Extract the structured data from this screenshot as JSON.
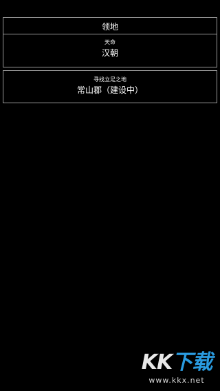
{
  "territory": {
    "header": "领地",
    "mandate_label": "天命",
    "mandate_value": "汉朝"
  },
  "quest": {
    "label": "寻找立足之地",
    "value": "常山郡（建设中）"
  },
  "watermark": {
    "title_part1": "KK",
    "title_part2": "下载",
    "url": "www.kkx.net",
    "accent_color": "#2a9be0"
  },
  "colors": {
    "background": "#000000",
    "border": "#9a9a9a",
    "text": "#ffffff"
  }
}
